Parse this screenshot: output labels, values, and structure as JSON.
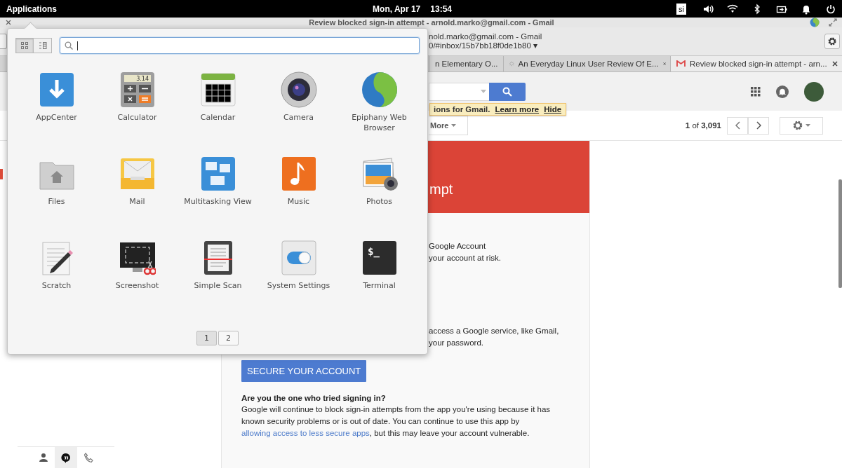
{
  "panel": {
    "menu": "Applications",
    "date": "Mon, Apr 17",
    "time": "13:54",
    "indicator_badge": "si"
  },
  "browser": {
    "title": "Review blocked sign-in attempt - arnold.marko@gmail.com - Gmail",
    "address_title": "nold.marko@gmail.com - Gmail",
    "address_url": "0/#inbox/15b7bb18f0de1b80 ▾",
    "tabs": [
      {
        "label": "n Elementary O...",
        "selected": false,
        "kind": "plain"
      },
      {
        "label": "An Everyday Linux User Review Of E...",
        "selected": false,
        "kind": "loading"
      },
      {
        "label": "Review blocked sign-in attempt - arn...",
        "selected": true,
        "kind": "mail"
      }
    ]
  },
  "gmail": {
    "banner": {
      "text": "ions for Gmail.",
      "links": [
        "Learn more",
        "Hide"
      ]
    },
    "more_button": "More",
    "pagination": "**1** of **3,091**",
    "email": {
      "header": "mpt",
      "lines_top": [
        "Google Account",
        "your account at risk."
      ],
      "lines_middle": [
        "access a Google service, like Gmail,",
        "your password."
      ],
      "button": "SECURE YOUR ACCOUNT",
      "question": "Are you the one who tried signing in?",
      "paragraph_before": "Google will continue to block sign-in attempts from the app you're using because it has known security problems or is out of date. You can continue to use this app by ",
      "link": "allowing access to less secure apps",
      "paragraph_after": ", but this may leave your account vulnerable."
    },
    "hangouts_tabs": [
      {
        "kind": "person",
        "selected": false
      },
      {
        "kind": "chat",
        "selected": true
      },
      {
        "kind": "phone",
        "selected": false
      }
    ]
  },
  "launcher": {
    "view_modes": [
      {
        "kind": "grid",
        "selected": true
      },
      {
        "kind": "list",
        "selected": false
      }
    ],
    "apps": [
      {
        "name": "AppCenter",
        "kind": "appcenter"
      },
      {
        "name": "Calculator",
        "kind": "calculator"
      },
      {
        "name": "Calendar",
        "kind": "calendar"
      },
      {
        "name": "Camera",
        "kind": "camera"
      },
      {
        "name": "Epiphany Web Browser",
        "kind": "globe"
      },
      {
        "name": "Files",
        "kind": "files"
      },
      {
        "name": "Mail",
        "kind": "mail"
      },
      {
        "name": "Multitasking View",
        "kind": "multitasking"
      },
      {
        "name": "Music",
        "kind": "music"
      },
      {
        "name": "Photos",
        "kind": "photos"
      },
      {
        "name": "Scratch",
        "kind": "scratch"
      },
      {
        "name": "Screenshot",
        "kind": "screenshot"
      },
      {
        "name": "Simple Scan",
        "kind": "scan"
      },
      {
        "name": "System Settings",
        "kind": "settings"
      },
      {
        "name": "Terminal",
        "kind": "terminal"
      }
    ],
    "calculator_display": "3.14",
    "terminal_prompt": "$_",
    "pages": [
      {
        "label": "1",
        "selected": true
      },
      {
        "label": "2",
        "selected": false
      }
    ]
  }
}
